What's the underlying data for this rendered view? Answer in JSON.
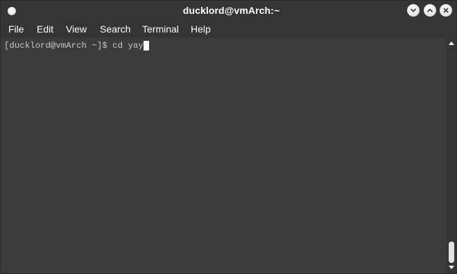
{
  "window": {
    "title": "ducklord@vmArch:~"
  },
  "menubar": {
    "items": [
      {
        "label": "File"
      },
      {
        "label": "Edit"
      },
      {
        "label": "View"
      },
      {
        "label": "Search"
      },
      {
        "label": "Terminal"
      },
      {
        "label": "Help"
      }
    ]
  },
  "terminal": {
    "prompt": "[ducklord@vmArch ~]$ ",
    "command": "cd yay"
  },
  "scrollbar": {
    "position_fraction": 1.0,
    "visible_fraction": 0.1
  },
  "colors": {
    "titlebar_bg": "#353538",
    "terminal_bg": "#3b3b3e",
    "text": "#c8c8c8",
    "cursor": "#ffffff"
  },
  "icons": {
    "window_menu": "circle-icon",
    "minimize": "chevron-down-icon",
    "maximize": "chevron-up-icon",
    "close": "close-icon"
  }
}
